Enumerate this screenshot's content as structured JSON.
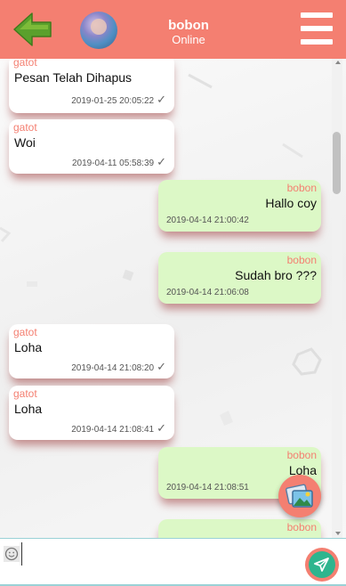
{
  "header": {
    "contact_name": "bobon",
    "contact_status": "Online"
  },
  "messages": [
    {
      "sender": "gatot",
      "text": "Pesan Telah Dihapus",
      "time": "2019-01-25 20:05:22",
      "check": "✓"
    },
    {
      "sender": "gatot",
      "text": "Woi",
      "time": "2019-04-11 05:58:39",
      "check": "✓"
    },
    {
      "sender": "bobon",
      "text": "Hallo coy",
      "time": "2019-04-14 21:00:42"
    },
    {
      "sender": "bobon",
      "text": "Sudah bro ???",
      "time": "2019-04-14 21:06:08"
    },
    {
      "sender": "gatot",
      "text": "Loha",
      "time": "2019-04-14 21:08:20",
      "check": "✓"
    },
    {
      "sender": "gatot",
      "text": "Loha",
      "time": "2019-04-14 21:08:41",
      "check": "✓"
    },
    {
      "sender": "bobon",
      "text": "Loha",
      "time": "2019-04-14 21:08:51"
    },
    {
      "sender": "bobon",
      "text": ""
    }
  ],
  "input": {
    "value": "",
    "placeholder": ""
  },
  "icons": {
    "back": "back-arrow-icon",
    "menu": "hamburger-menu-icon",
    "image": "image-gallery-icon",
    "emoji": "emoji-icon",
    "send": "send-icon"
  },
  "colors": {
    "header": "#f47f71",
    "incoming_bubble": "#ffffff",
    "outgoing_bubble": "#dcf8c6",
    "sender_name": "#f47f71",
    "send_button": "#2eb58e",
    "back_arrow": "#5aa02c"
  }
}
